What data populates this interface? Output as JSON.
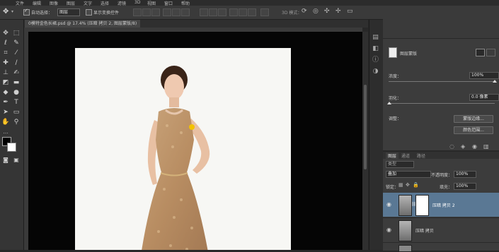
{
  "menubar": {
    "items": [
      "文件",
      "编辑",
      "图像",
      "图层",
      "文字",
      "选择",
      "滤镜",
      "3D",
      "视图",
      "窗口",
      "帮助"
    ]
  },
  "options": {
    "auto_select_label": "自动选择：",
    "auto_select_value": "图层",
    "show_transform_label": "显示变换控件",
    "mode_3d_label": "3D 模式："
  },
  "document": {
    "tab_title": "0模特金色长裙.psd @ 17.4% (压暗 拷贝 2, 图层蒙版/8)"
  },
  "properties": {
    "panel_label": "图层蒙版",
    "density_label": "浓度：",
    "density_value": "100%",
    "feather_label": "羽化：",
    "feather_value": "0.0 像素",
    "adjust_label": "调整：",
    "mask_edge_button": "蒙版边缘...",
    "color_range_button": "颜色范围..."
  },
  "layers_panel": {
    "tabs": [
      "图层",
      "通道",
      "路径"
    ],
    "kind_filter": "类型",
    "blend_mode": "叠加",
    "opacity_label": "不透明度：",
    "opacity_value": "100%",
    "lock_label": "锁定：",
    "fill_label": "填充：",
    "fill_value": "100%",
    "layers": [
      {
        "name": "压暗 拷贝 2",
        "selected": true
      },
      {
        "name": "压暗 拷贝",
        "selected": false
      }
    ]
  },
  "colors": {
    "accent_selected": "#5a7894",
    "canvas": "#050505",
    "panel": "#3c3c3c"
  }
}
